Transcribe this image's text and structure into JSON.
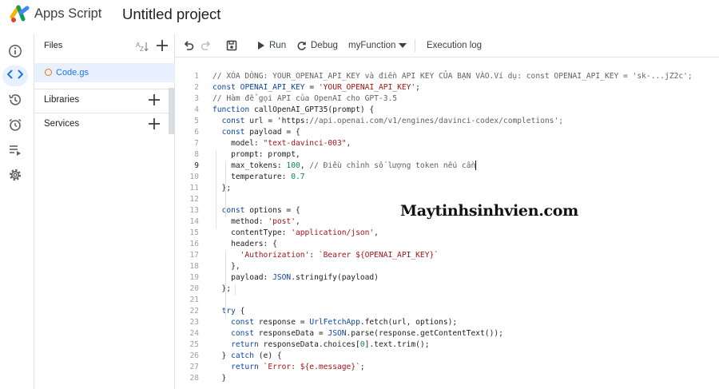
{
  "header": {
    "app_name": "Apps Script",
    "project_title": "Untitled project",
    "logo": "apps-script-logo"
  },
  "rail": {
    "items": [
      {
        "icon": "info-icon",
        "label": "Overview"
      },
      {
        "icon": "code-icon",
        "label": "Editor",
        "active": true
      },
      {
        "icon": "history-icon",
        "label": "Project history"
      },
      {
        "icon": "alarm-icon",
        "label": "Triggers"
      },
      {
        "icon": "executions-icon",
        "label": "Executions"
      },
      {
        "icon": "gear-icon",
        "label": "Project settings"
      }
    ]
  },
  "files": {
    "title": "Files",
    "items": [
      {
        "name": "Code.gs",
        "selected": true
      }
    ],
    "sections": [
      {
        "label": "Libraries"
      },
      {
        "label": "Services"
      }
    ]
  },
  "toolbar": {
    "run_label": "Run",
    "debug_label": "Debug",
    "function_select": "myFunction",
    "execution_log_label": "Execution log"
  },
  "editor": {
    "active_line": 9,
    "lines": [
      "// XÓA DÒNG: YOUR_OPENAI_API_KEY và điền API KEY CỦA BẠN VÀO.Ví dụ: const OPENAI_API_KEY = 'sk-...jZ2c';",
      "const OPENAI_API_KEY = 'YOUR_OPENAI_API_KEY';",
      "// Hàm để gọi API của OpenAI cho GPT-3.5",
      "function callOpenAI_GPT35(prompt) {",
      "  const url = 'https://api.openai.com/v1/engines/davinci-codex/completions';",
      "  const payload = {",
      "    model: \"text-davinci-003\",",
      "    prompt: prompt,",
      "    max_tokens: 100, // Điều chỉnh số lượng token nếu cần",
      "    temperature: 0.7",
      "  };",
      "",
      "  const options = {",
      "    method: 'post',",
      "    contentType: 'application/json',",
      "    headers: {",
      "      'Authorization': `Bearer ${OPENAI_API_KEY}`",
      "    },",
      "    payload: JSON.stringify(payload)",
      "  };",
      "",
      "  try {",
      "    const response = UrlFetchApp.fetch(url, options);",
      "    const responseData = JSON.parse(response.getContentText());",
      "    return responseData.choices[0].text.trim();",
      "  } catch (e) {",
      "    return `Error: ${e.message}`;",
      "  }"
    ]
  },
  "watermark": "Maytinhsinhvien.com",
  "colors": {
    "accent": "#1a73e8",
    "active_bg": "#e8f0fe",
    "keyword": "#0d47a1",
    "string": "#a31515",
    "number": "#098658",
    "comment": "#616161",
    "file_dot": "#e8710a"
  }
}
